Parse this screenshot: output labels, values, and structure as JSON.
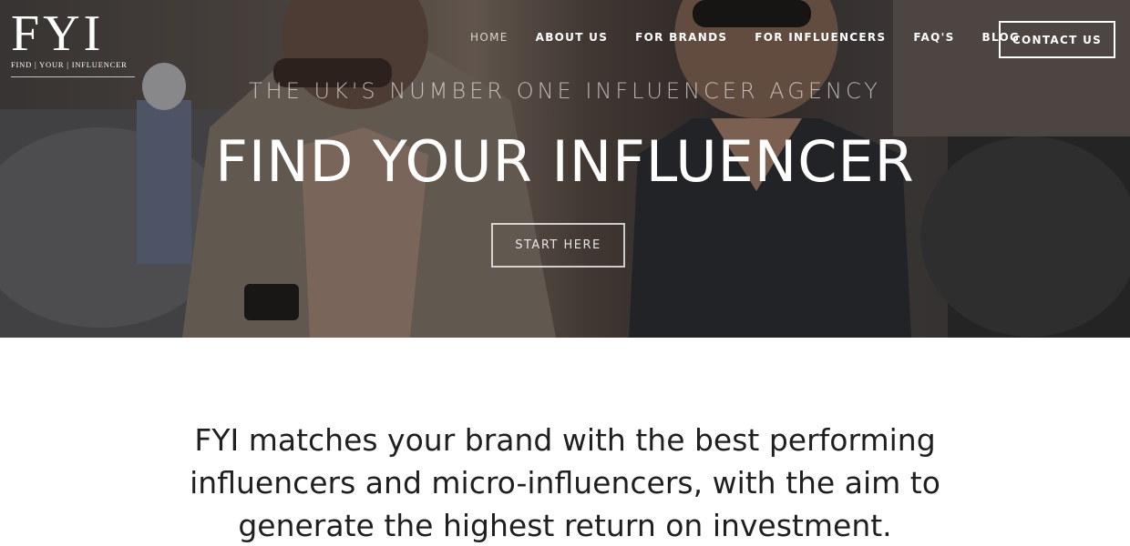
{
  "brand": {
    "logo_text": "FYI",
    "tagline": "FIND | YOUR | INFLUENCER"
  },
  "nav": {
    "items": [
      {
        "label": "HOME",
        "active": true
      },
      {
        "label": "ABOUT US",
        "active": false
      },
      {
        "label": "FOR BRANDS",
        "active": false
      },
      {
        "label": "FOR INFLUENCERS",
        "active": false
      },
      {
        "label": "FAQ'S",
        "active": false
      },
      {
        "label": "BLOG",
        "active": false
      }
    ],
    "contact_label": "CONTACT US"
  },
  "hero": {
    "kicker": "THE UK'S NUMBER ONE INFLUENCER AGENCY",
    "title": "FIND YOUR INFLUENCER",
    "cta_label": "START HERE"
  },
  "intro": {
    "text": "FYI matches your brand with the best performing influencers and micro-influencers, with the aim to generate the highest return on investment."
  },
  "colors": {
    "nav_text": "#ffffff",
    "nav_active": "#d8d4cf",
    "body_text": "#1f1f1f",
    "background": "#ffffff"
  }
}
